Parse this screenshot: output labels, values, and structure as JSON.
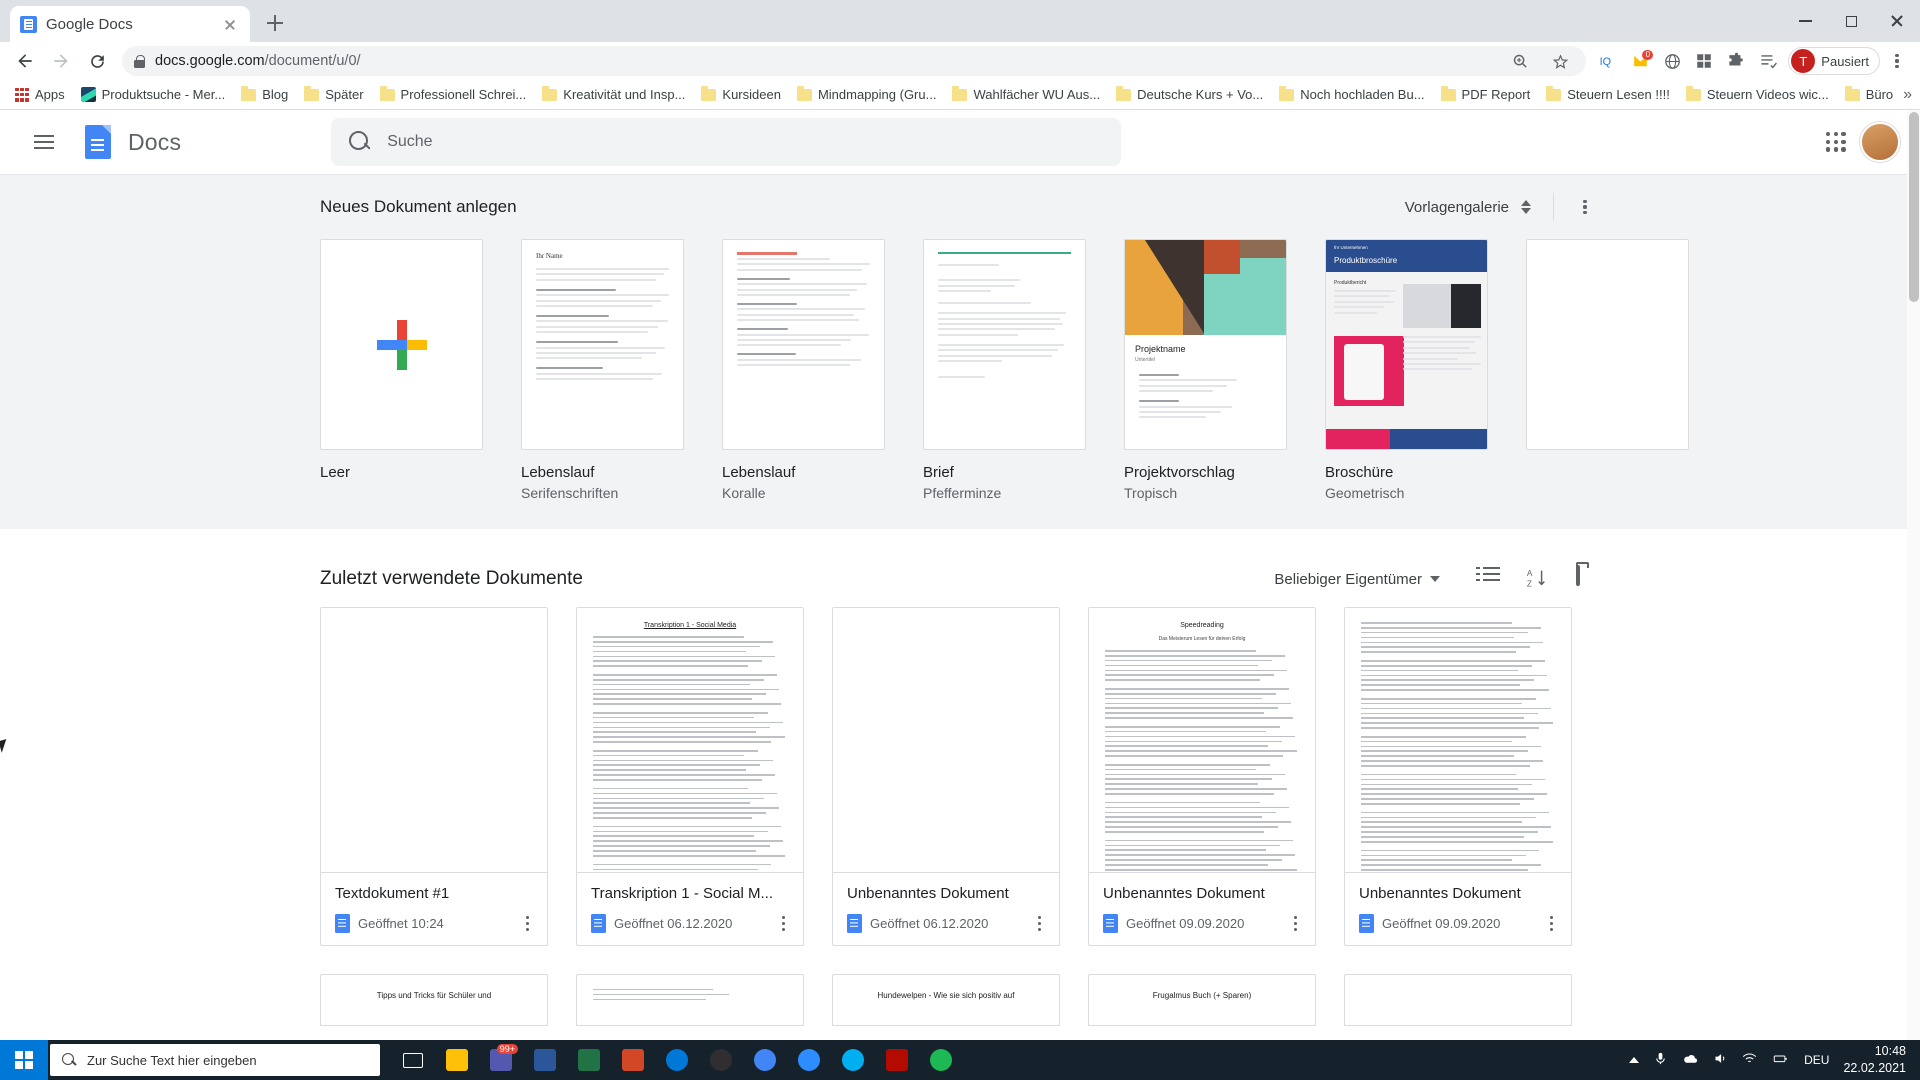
{
  "browser": {
    "tab": {
      "title": "Google Docs",
      "favicon": "google-docs-favicon"
    },
    "new_tab_label": "+",
    "url": "docs.google.com/document/u/0/",
    "url_host": "docs.google.com",
    "url_path": "/document/u/0/",
    "profile_name": "Pausiert",
    "profile_initial": "T",
    "extension_badge": "0",
    "bookmarks": [
      {
        "label": "Apps",
        "icon": "apps-grid-icon"
      },
      {
        "label": "Produktsuche - Mer...",
        "icon": "site-favicon"
      },
      {
        "label": "Blog",
        "icon": "folder-icon"
      },
      {
        "label": "Später",
        "icon": "folder-icon"
      },
      {
        "label": "Professionell Schrei...",
        "icon": "folder-icon"
      },
      {
        "label": "Kreativität und Insp...",
        "icon": "folder-icon"
      },
      {
        "label": "Kursideen",
        "icon": "folder-icon"
      },
      {
        "label": "Mindmapping  (Gru...",
        "icon": "folder-icon"
      },
      {
        "label": "Wahlfächer WU Aus...",
        "icon": "folder-icon"
      },
      {
        "label": "Deutsche Kurs + Vo...",
        "icon": "folder-icon"
      },
      {
        "label": "Noch hochladen Bu...",
        "icon": "folder-icon"
      },
      {
        "label": "PDF Report",
        "icon": "folder-icon"
      },
      {
        "label": "Steuern Lesen !!!!",
        "icon": "folder-icon"
      },
      {
        "label": "Steuern Videos wic...",
        "icon": "folder-icon"
      },
      {
        "label": "Büro",
        "icon": "folder-icon"
      }
    ],
    "bookmarks_overflow": "»"
  },
  "docs": {
    "app_name": "Docs",
    "search": {
      "placeholder": "Suche"
    },
    "templates": {
      "heading": "Neues Dokument anlegen",
      "gallery_label": "Vorlagengalerie",
      "items": [
        {
          "name": "Leer",
          "sub": "",
          "thumb": "blank-plus"
        },
        {
          "name": "Lebenslauf",
          "sub": "Serifenschriften",
          "thumb": "resume-serif"
        },
        {
          "name": "Lebenslauf",
          "sub": "Koralle",
          "thumb": "resume-coral"
        },
        {
          "name": "Brief",
          "sub": "Pfefferminze",
          "thumb": "letter-mint"
        },
        {
          "name": "Projektvorschlag",
          "sub": "Tropisch",
          "thumb": "proposal-tropic"
        },
        {
          "name": "Broschüre",
          "sub": "Geometrisch",
          "thumb": "brochure-geometric"
        }
      ]
    },
    "recent": {
      "heading": "Zuletzt verwendete Dokumente",
      "owner_filter": "Beliebiger Eigentümer",
      "view_list_icon": "list-view-icon",
      "sort_icon": "sort-az-icon",
      "folder_icon": "open-folder-icon",
      "documents": [
        {
          "title": "Textdokument #1",
          "opened": "Geöffnet 10:24"
        },
        {
          "title": "Transkription 1 - Social M...",
          "opened": "Geöffnet 06.12.2020"
        },
        {
          "title": "Unbenanntes Dokument",
          "opened": "Geöffnet 06.12.2020"
        },
        {
          "title": "Unbenanntes Dokument",
          "opened": "Geöffnet 09.09.2020"
        },
        {
          "title": "Unbenanntes Dokument",
          "opened": "Geöffnet 09.09.2020"
        }
      ],
      "documents_row2": [
        {
          "title": "Tipps und Tricks für Schüler und"
        },
        {
          "title": ""
        },
        {
          "title": "Hundewelpen - Wie sie sich positiv auf"
        },
        {
          "title": "Frugalmus Buch (+ Sparen)"
        },
        {
          "title": ""
        }
      ]
    },
    "thumb_text": {
      "resume_serif_name": "Ihr Name",
      "proposal_title": "Projektname",
      "brochure_title": "Produktbroschüre",
      "transkription_heading": "Transkription 1 - Social Media",
      "speedreading_title": "Speedreading",
      "speedreading_sub": "Das Meisterum Lesen für deinen Erfolg"
    }
  },
  "taskbar": {
    "search_placeholder": "Zur Suche Text hier eingeben",
    "apps": [
      {
        "name": "task-view",
        "color": "#ffffff"
      },
      {
        "name": "file-explorer",
        "color": "#ffc107"
      },
      {
        "name": "teams",
        "color": "#5558af",
        "badge": "99+"
      },
      {
        "name": "word",
        "color": "#2b579a"
      },
      {
        "name": "excel",
        "color": "#217346"
      },
      {
        "name": "powerpoint",
        "color": "#d24726"
      },
      {
        "name": "edge",
        "color": "#0078d7"
      },
      {
        "name": "obs",
        "color": "#302e31"
      },
      {
        "name": "chrome",
        "color": "#4285f4"
      },
      {
        "name": "zoom",
        "color": "#2d8cff"
      },
      {
        "name": "skype",
        "color": "#00aff0"
      },
      {
        "name": "acrobat",
        "color": "#b30b00"
      },
      {
        "name": "spotify",
        "color": "#1db954"
      }
    ],
    "language": "DEU",
    "time": "10:48",
    "date": "22.02.2021"
  }
}
